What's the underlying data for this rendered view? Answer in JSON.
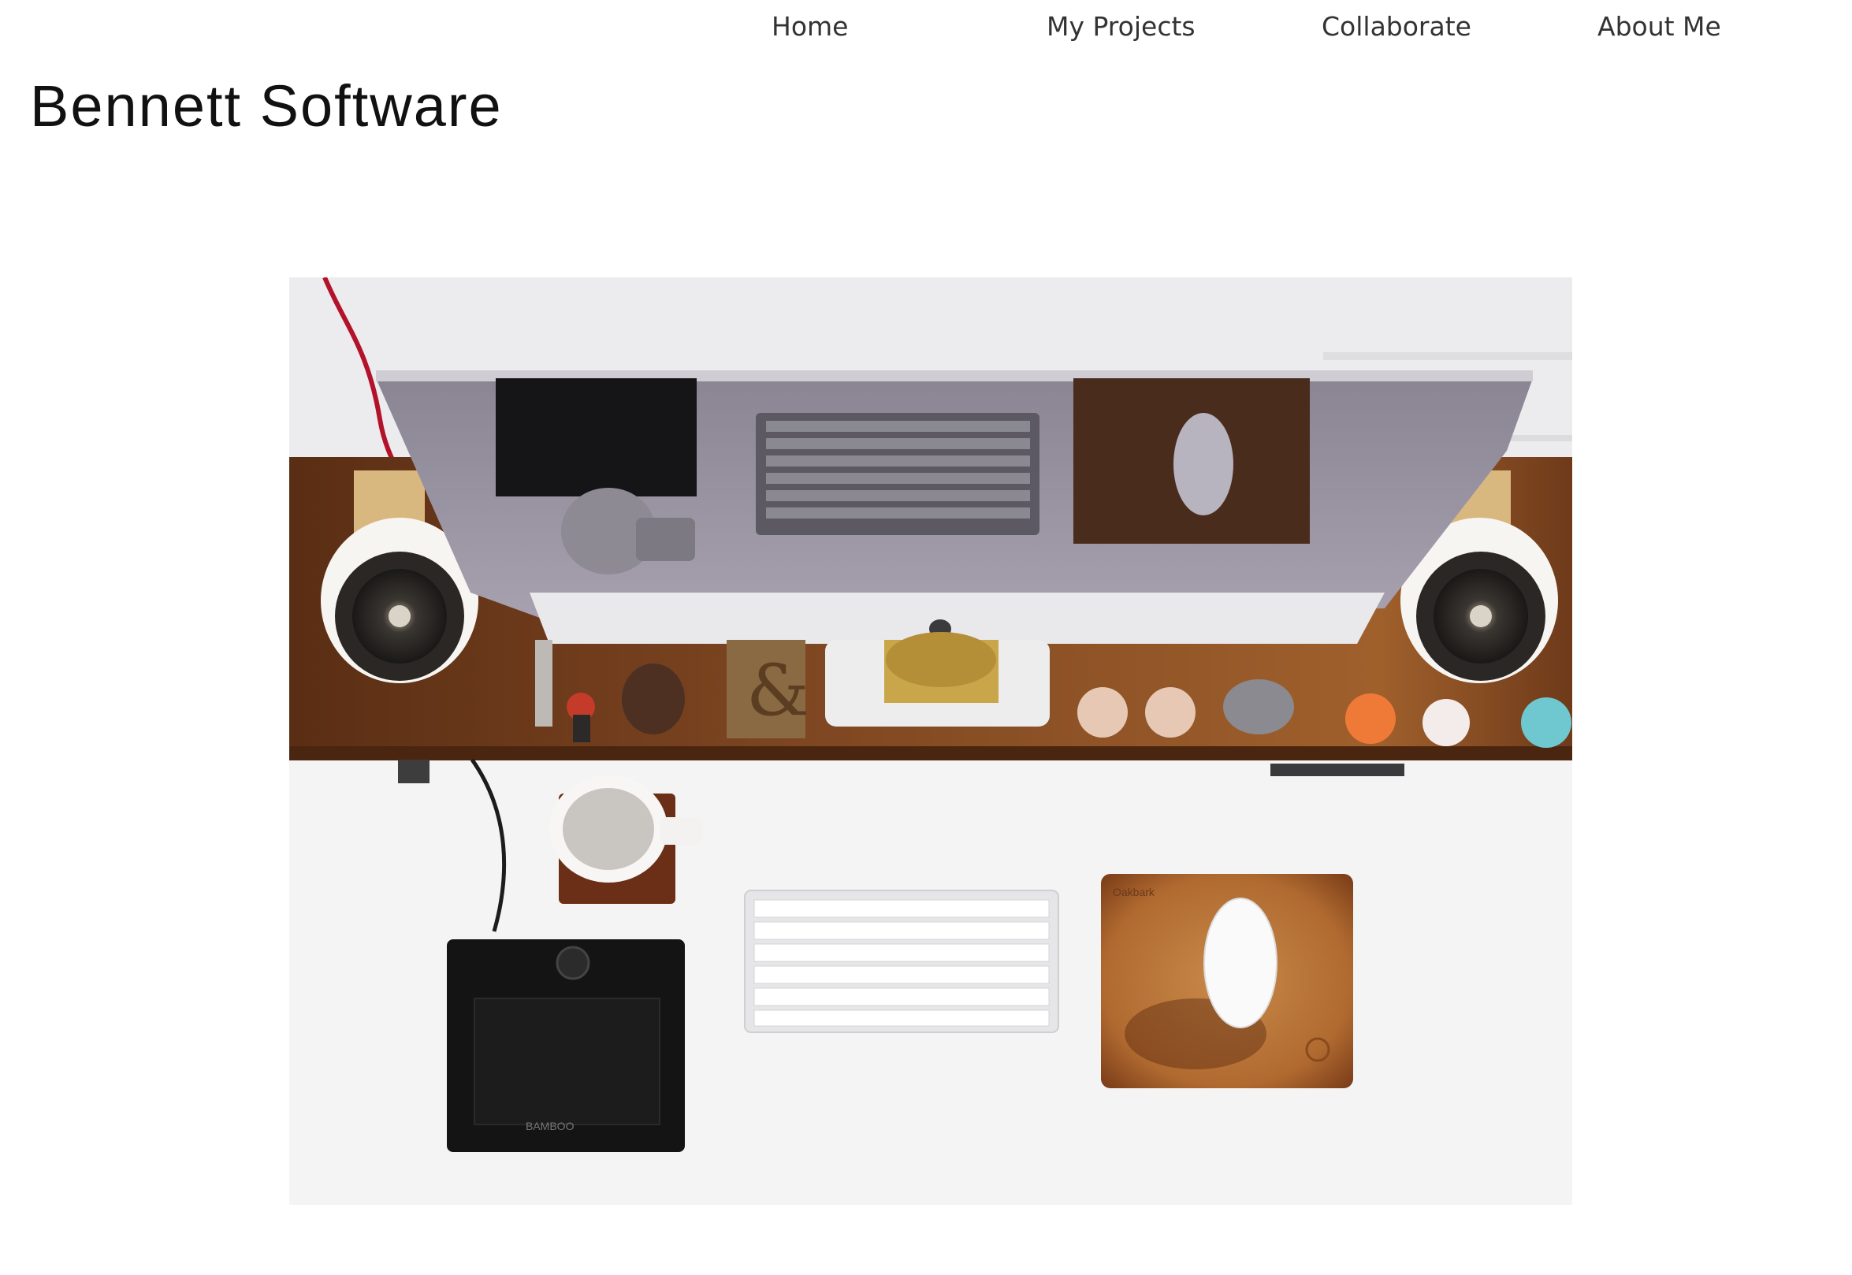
{
  "site": {
    "brand": "Bennett Software"
  },
  "nav": {
    "items": [
      {
        "label": "Home"
      },
      {
        "label": "My Projects"
      },
      {
        "label": "Collaborate"
      },
      {
        "label": "About Me"
      }
    ]
  },
  "hero": {
    "tablet_brand": "BAMBOO",
    "mousepad_brand": "Oakbark"
  },
  "colors": {
    "text": "#333333",
    "brand_text": "#111111",
    "background": "#ffffff",
    "wood": "#6b3a1c",
    "desk": "#f2f2f3"
  }
}
